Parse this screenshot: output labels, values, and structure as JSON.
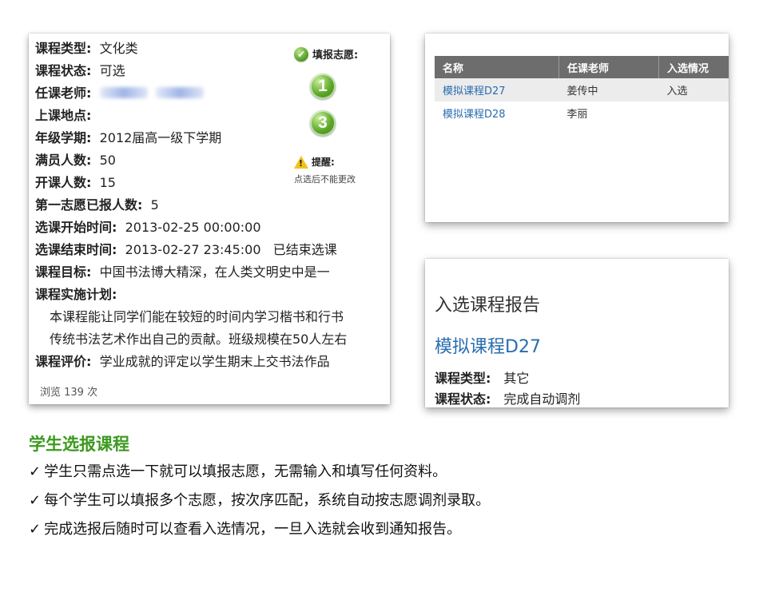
{
  "left_panel": {
    "fields": [
      {
        "label": "课程类型:",
        "value": "文化类"
      },
      {
        "label": "课程状态:",
        "value": "可选"
      },
      {
        "label": "任课老师:",
        "value": ""
      },
      {
        "label": "上课地点:",
        "value": ""
      },
      {
        "label": "年级学期:",
        "value": "2012届高一级下学期"
      },
      {
        "label": "满员人数:",
        "value": "50"
      },
      {
        "label": "开课人数:",
        "value": "15"
      },
      {
        "label": "第一志愿已报人数:",
        "value": "5"
      },
      {
        "label": "选课开始时间:",
        "value": "2013-02-25 00:00:00"
      },
      {
        "label": "选课结束时间:",
        "value": "2013-02-27 23:45:00   已结束选课"
      },
      {
        "label": "课程目标:",
        "value": "中国书法博大精深，在人类文明史中是一"
      },
      {
        "label": "课程实施计划:",
        "value": ""
      },
      {
        "label": "课程评价:",
        "value": "学业成就的评定以学生期末上交书法作品"
      }
    ],
    "plan_lines": [
      "本课程能让同学们能在较短的时间内学习楷书和行书",
      "传统书法艺术作出自己的贡献。班级规模在50人左右"
    ],
    "views": "浏览 139 次",
    "fill_title": "填报志愿:",
    "choices": [
      "1",
      "3"
    ],
    "warning_title": "提醒:",
    "warning_text": "点选后不能更改"
  },
  "enrollment_table": {
    "headers": [
      "名称",
      "任课老师",
      "入选情况"
    ],
    "rows": [
      {
        "name": "模拟课程D27",
        "teacher": "姜传中",
        "status": "入选"
      },
      {
        "name": "模拟课程D28",
        "teacher": "李丽",
        "status": ""
      }
    ]
  },
  "report": {
    "heading": "入选课程报告",
    "course_name": "模拟课程D27",
    "fields": [
      {
        "label": "课程类型:",
        "value": "其它"
      },
      {
        "label": "课程状态:",
        "value": "完成自动调剂"
      }
    ]
  },
  "section": {
    "title": "学生选报课程",
    "features": [
      "学生只需点选一下就可以填报志愿，无需输入和填写任何资料。",
      "每个学生可以填报多个志愿，按次序匹配，系统自动按志愿调剂录取。",
      "完成选报后随时可以查看入选情况，一旦入选就会收到通知报告。"
    ],
    "tick": "✓"
  },
  "colors": {
    "accent_green": "#3c9a1f",
    "link_blue": "#2a6db0",
    "header_gray": "#6d6d6d"
  }
}
